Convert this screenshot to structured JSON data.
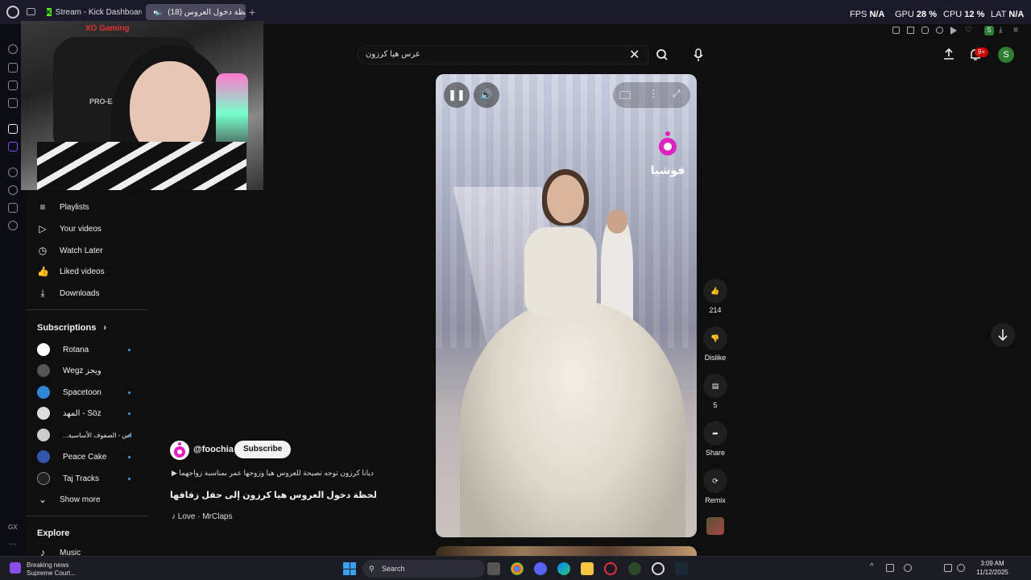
{
  "browser": {
    "tabs": [
      {
        "label": "Stream - Kick Dashboard",
        "active": false
      },
      {
        "label": "لحظة دخول العروس (18)",
        "active": true
      }
    ],
    "new_tab": "+"
  },
  "overlay_stats": {
    "fps_label": "FPS",
    "fps_value": "N/A",
    "gpu_label": "GPU",
    "gpu_value": "28 %",
    "cpu_label": "CPU",
    "cpu_value": "12 %",
    "lat_label": "LAT",
    "lat_value": "N/A"
  },
  "search": {
    "query": "عرس هيا كرزون",
    "clear_icon": "close-icon",
    "search_icon": "search-icon",
    "mic_icon": "mic-icon"
  },
  "header": {
    "notification_badge": "9+",
    "avatar_letter": "S"
  },
  "nav": {
    "you_items": [
      {
        "label": "Playlists",
        "icon": "playlist-icon"
      },
      {
        "label": "Your videos",
        "icon": "video-icon"
      },
      {
        "label": "Watch Later",
        "icon": "clock-icon"
      },
      {
        "label": "Liked videos",
        "icon": "thumbs-up-icon"
      },
      {
        "label": "Downloads",
        "icon": "download-icon"
      }
    ],
    "subscriptions_title": "Subscriptions",
    "subscriptions": [
      {
        "label": "Rotana",
        "color": "#ffffff",
        "dot": true
      },
      {
        "label": "Wegz ويجز",
        "color": "#555555",
        "dot": false
      },
      {
        "label": "Spacetoon",
        "color": "#2f86d6",
        "dot": true
      },
      {
        "label": "المهد - Söz",
        "color": "#dddddd",
        "dot": true
      },
      {
        "label": "...اس - الصفوف الأساسية",
        "color": "#cccccc",
        "dot": true
      },
      {
        "label": "Peace Cake",
        "color": "#3355aa",
        "dot": true
      },
      {
        "label": "Taj Tracks",
        "color": "#222222",
        "dot": true
      }
    ],
    "show_more": "Show more",
    "explore_title": "Explore",
    "explore_items": [
      {
        "label": "Music"
      }
    ]
  },
  "video": {
    "watermark": "فوشيا",
    "channel_handle": "@foochia",
    "subscribe_label": "Subscribe",
    "description": "▶ ديانا كرزون توجه نصيحة للعروس هيا وزوجها عمر بمناسبة زواجهما",
    "title": "لحظة دخول العروس هيا كرزون إلى حفل زفافها",
    "music": "♪ Love · MrClaps",
    "likes": "214",
    "dislike_label": "Dislike",
    "comments": "5",
    "share_label": "Share",
    "remix_label": "Remix"
  },
  "webcam": {
    "brand": "XO Gaming",
    "chair_text": "PRO-EAI"
  },
  "taskbar": {
    "news_line1": "Breaking news",
    "news_line2": "Supreme Court...",
    "search_label": "Search",
    "time": "3:09 AM",
    "date": "11/12/2025"
  },
  "colors": {
    "accent_red": "#cc0000",
    "subscribe_bg": "#f1f1f1",
    "avatar_green": "#2e7d32",
    "kick_green": "#53fc18"
  }
}
